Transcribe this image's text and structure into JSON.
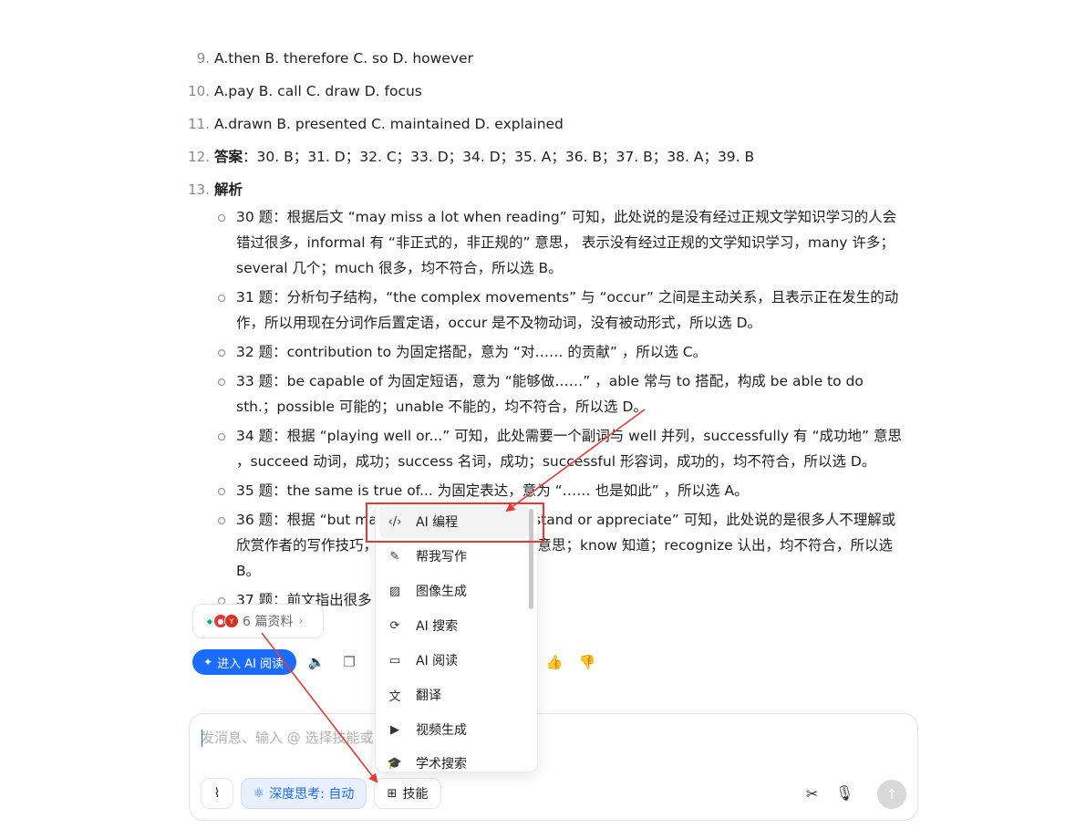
{
  "list": [
    {
      "num": "9.",
      "text": "A.then B. therefore C. so D. however"
    },
    {
      "num": "10.",
      "text": "A.pay B. call C. draw D. focus"
    },
    {
      "num": "11.",
      "text": "A.drawn B. presented C. maintained D. explained"
    },
    {
      "num": "12.",
      "label": "答案",
      "text": "：30. B；31. D；32. C；33. D；34. D；35. A；36. B；37. B；38. A；39. B"
    },
    {
      "num": "13.",
      "label": "解析"
    }
  ],
  "bullets": [
    "30 题：根据后文 “may miss a lot when reading” 可知，此处说的是没有经过正规文学知识学习的人会错过很多，informal 有 “非正式的，非正规的” 意思， 表示没有经过正规的文学知识学习，many 许多；several 几个；much 很多，均不符合，所以选 B。",
    "31 题：分析句子结构，“the complex movements” 与 “occur” 之间是主动关系，且表示正在发生的动作，所以用现在分词作后置定语，occur 是不及物动词，没有被动形式，所以选 D。",
    "32 题：contribution to 为固定搭配，意为 “对…… 的贡献” ，所以选 C。",
    "33 题：be capable of 为固定短语，意为 “能够做……” ，able 常与 to 搭配，构成 be able to do sth.；possible 可能的；unable 不能的，均不符合，所以选 D。",
    "34 题：根据 “playing well or...” 可知，此处需要一个副词与 well 并列，successfully 有 “成功地” 意思 ，succeed 动词，成功；success 名词，成功；successful 形容词，成功的，均不符合，所以选 D。",
    "35 题：the same is true of... 为固定表达，意为 “…… 也是如此” ，所以选 A。",
    "36 题：根据 “but many people don't understand or appreciate” 可知，此处说的是很多人不理解或欣赏作者的写作技巧，appreciate 有 “欣赏” 的意思；know 知道；recognize 认出，均不符合，所以选 B。",
    "37 题：前文指出很多"
  ],
  "sources": {
    "count_label": "6 篇资料",
    "icon_c_label": "Y"
  },
  "actions": {
    "ai_read_label": "进入 AI 阅读"
  },
  "composer": {
    "placeholder": "发消息、输入 @ 选择技能或",
    "deep_think_label": "深度思考: 自动",
    "skills_label": "技能"
  },
  "skills_menu": [
    {
      "label": "AI 编程",
      "icon": "code-icon",
      "active": true
    },
    {
      "label": "帮我写作",
      "icon": "pen-icon"
    },
    {
      "label": "图像生成",
      "icon": "image-icon"
    },
    {
      "label": "AI 搜索",
      "icon": "search-icon"
    },
    {
      "label": "AI 阅读",
      "icon": "book-icon"
    },
    {
      "label": "翻译",
      "icon": "translate-icon"
    },
    {
      "label": "视频生成",
      "icon": "video-icon"
    },
    {
      "label": "学术搜索",
      "icon": "academic-icon"
    }
  ],
  "colors": {
    "accent": "#1a6cff",
    "annotation": "#e53935"
  }
}
